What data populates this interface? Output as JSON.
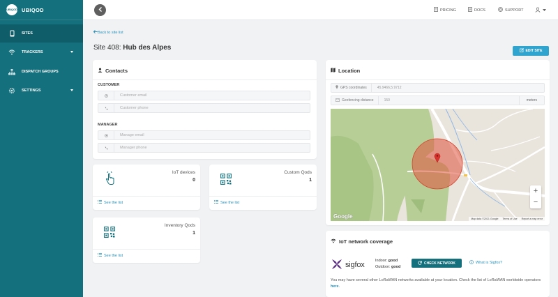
{
  "brand": {
    "logo_line1": "UBI",
    "logo_line2": "QOD",
    "name": "UBIQOD"
  },
  "sidebar": {
    "items": [
      {
        "label": "SITES"
      },
      {
        "label": "TRACKERS"
      },
      {
        "label": "DISPATCH GROUPS"
      },
      {
        "label": "SETTINGS"
      }
    ]
  },
  "topbar": {
    "pricing": "PRICING",
    "docs": "DOCS",
    "support": "SUPPORT"
  },
  "page": {
    "back_label": "Back to site list",
    "site_prefix": "Site 408:",
    "site_name": "Hub des Alpes",
    "edit_label": "EDIT SITE"
  },
  "contacts": {
    "title": "Contacts",
    "customer_label": "CUSTOMER",
    "customer_email_placeholder": "Customer email",
    "customer_phone_placeholder": "Customer phone",
    "manager_label": "MANAGER",
    "manager_email_placeholder": "Manage email",
    "manager_phone_placeholder": "Manager phone"
  },
  "stats": {
    "iot_label": "IoT devices",
    "iot_value": "0",
    "custom_label": "Custom Qods",
    "custom_value": "1",
    "inventory_label": "Inventory Qods",
    "inventory_value": "1",
    "see_list": "See the list"
  },
  "location": {
    "title": "Location",
    "gps_label": "GPS coordinates",
    "gps_value": "45.9466,5.9712",
    "geofence_label": "Geofencing distance",
    "geofence_value": "150",
    "geofence_unit": "meters",
    "map_google": "Google",
    "map_data": "Map data ©2021 Google",
    "map_terms": "Terms of Use",
    "map_report": "Report a map error",
    "zoom_in": "+",
    "zoom_out": "−"
  },
  "iot": {
    "title": "IoT network coverage",
    "network": "sigfox",
    "indoor_label": "Indoor:",
    "indoor_value": "good",
    "outdoor_label": "Outdoor:",
    "outdoor_value": "good",
    "check_label": "CHECK NETWORK",
    "what_label": "What is Sigfox?",
    "info_text": "You may have several other LoRaWAN networks available at your location. Check the list of LoRaWAN worldwide operators",
    "info_link": "here",
    "info_end": "."
  },
  "colors": {
    "sidebar": "#13707c",
    "accent": "#2fa4cf",
    "link": "#2b8fb7",
    "geofence": "#e0523c"
  }
}
